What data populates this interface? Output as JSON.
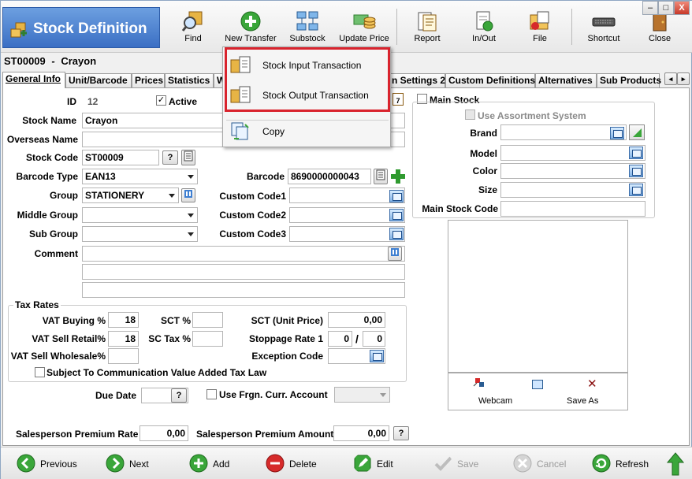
{
  "window": {
    "title": "Stock Definition",
    "minimize": "–",
    "maximize": "□",
    "close": "X"
  },
  "toolbar": [
    {
      "label": "Find",
      "icon": "find-icon"
    },
    {
      "label": "New Transfer",
      "icon": "plus-icon"
    },
    {
      "label": "Substock",
      "icon": "substock-icon"
    },
    {
      "label": "Update Price",
      "icon": "update-price-icon"
    },
    {
      "label": "Report",
      "icon": "report-icon"
    },
    {
      "label": "In/Out",
      "icon": "in-out-icon"
    },
    {
      "label": "File",
      "icon": "file-icon"
    },
    {
      "label": "Shortcut",
      "icon": "keyboard-icon"
    },
    {
      "label": "Close",
      "icon": "door-icon"
    }
  ],
  "record": {
    "code": "ST00009",
    "separator": "-",
    "name": "Crayon"
  },
  "tabs": [
    {
      "label": "General Info",
      "active": true
    },
    {
      "label": "Unit/Barcode"
    },
    {
      "label": "Prices"
    },
    {
      "label": "Statistics"
    },
    {
      "label": "W"
    },
    {
      "label": "n Settings 2"
    },
    {
      "label": "Custom Definitions"
    },
    {
      "label": "Alternatives"
    },
    {
      "label": "Sub Products"
    }
  ],
  "popup_menu": {
    "items": [
      {
        "label": "Stock Input Transaction",
        "icon": "stock-input-icon"
      },
      {
        "label": "Stock Output Transaction",
        "icon": "stock-output-icon"
      },
      {
        "label": "Copy",
        "icon": "copy-icon"
      }
    ]
  },
  "general": {
    "id_label": "ID",
    "id_value": "12",
    "active_label": "Active",
    "active_checked": true,
    "stock_name_label": "Stock Name",
    "stock_name_value": "Crayon",
    "overseas_name_label": "Overseas Name",
    "overseas_name_value": "",
    "stock_code_label": "Stock Code",
    "stock_code_value": "ST00009",
    "barcode_type_label": "Barcode Type",
    "barcode_type_value": "EAN13",
    "barcode_label": "Barcode",
    "barcode_value": "8690000000043",
    "group_label": "Group",
    "group_value": "STATIONERY",
    "middle_group_label": "Middle Group",
    "middle_group_value": "",
    "sub_group_label": "Sub Group",
    "sub_group_value": "",
    "custom_code1_label": "Custom Code1",
    "custom_code2_label": "Custom Code2",
    "custom_code3_label": "Custom Code3",
    "comment_label": "Comment",
    "question_mark": "?",
    "date_day": "7"
  },
  "main_stock": {
    "main_stock_label": "Main Stock",
    "main_stock_checked": false,
    "assortment_label": "Use Assortment System",
    "assortment_checked": false,
    "brand_label": "Brand",
    "model_label": "Model",
    "color_label": "Color",
    "size_label": "Size",
    "main_stock_code_label": "Main Stock Code"
  },
  "tax": {
    "title": "Tax Rates",
    "vat_buying_label": "VAT Buying %",
    "vat_buying_value": "18",
    "vat_sell_retail_label": "VAT Sell Retail%",
    "vat_sell_retail_value": "18",
    "vat_sell_wholesale_label": "VAT Sell Wholesale%",
    "vat_sell_wholesale_value": "",
    "sct_label": "SCT %",
    "sct_value": "",
    "sc_tax_label": "SC Tax %",
    "sc_tax_value": "",
    "sct_unit_label": "SCT (Unit Price)",
    "sct_unit_value": "0,00",
    "stoppage_label": "Stoppage Rate 1",
    "stoppage_a": "0",
    "stoppage_sep": "/",
    "stoppage_b": "0",
    "exception_label": "Exception Code",
    "subject_label": "Subject To Communication Value Added Tax Law",
    "subject_checked": false
  },
  "misc": {
    "due_date_label": "Due Date",
    "frgn_label": "Use Frgn. Curr. Account",
    "frgn_checked": false,
    "sp_rate_label": "Salesperson Premium Rate",
    "sp_rate_value": "0,00",
    "sp_amount_label": "Salesperson Premium Amount",
    "sp_amount_value": "0,00"
  },
  "image_panel": {
    "webcam_label": "Webcam",
    "save_as_label": "Save As",
    "delete_symbol": "✕"
  },
  "bottom": [
    {
      "label": "Previous",
      "enabled": true,
      "color": "#3aa63a"
    },
    {
      "label": "Next",
      "enabled": true,
      "color": "#3aa63a"
    },
    {
      "label": "Add",
      "enabled": true,
      "color": "#3aa63a"
    },
    {
      "label": "Delete",
      "enabled": true,
      "color": "#d62b2b"
    },
    {
      "label": "Edit",
      "enabled": true,
      "color": "#3aa63a"
    },
    {
      "label": "Save",
      "enabled": false,
      "color": "#bdbdbd"
    },
    {
      "label": "Cancel",
      "enabled": false,
      "color": "#bdbdbd"
    },
    {
      "label": "Refresh",
      "enabled": true,
      "color": "#3aa63a"
    }
  ],
  "colors": {
    "title_bg": "#4a7fd0",
    "highlight": "#d9232d",
    "accent_green": "#3aa63a"
  }
}
